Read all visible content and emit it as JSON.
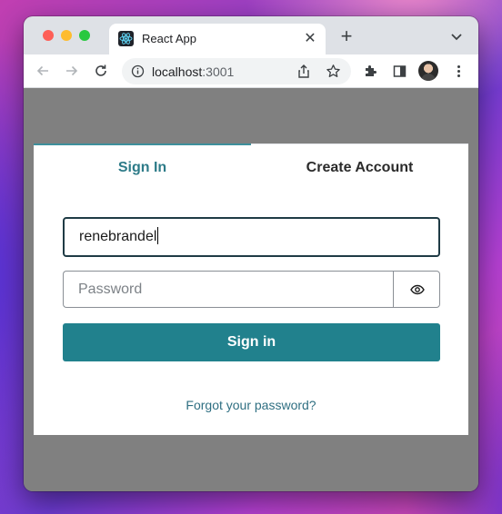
{
  "browser": {
    "tab_title": "React App",
    "url_host": "localhost",
    "url_port": ":3001",
    "icons": [
      "react-favicon",
      "close-icon",
      "plus-icon",
      "chevron-down-icon",
      "back-arrow-icon",
      "forward-arrow-icon",
      "reload-icon",
      "info-icon",
      "share-icon",
      "star-icon",
      "puzzle-icon",
      "sidebar-icon",
      "kebab-menu-icon"
    ]
  },
  "auth": {
    "tab_signin": "Sign In",
    "tab_create": "Create Account",
    "username_value": "renebrandel",
    "password_placeholder": "Password",
    "signin_button": "Sign in",
    "forgot_link": "Forgot your password?",
    "show_password_icon": "eye-icon"
  },
  "colors": {
    "accent": "#21818d",
    "active_tab_text": "#2d7b88",
    "link": "#2f6f82",
    "backdrop": "#808080"
  }
}
